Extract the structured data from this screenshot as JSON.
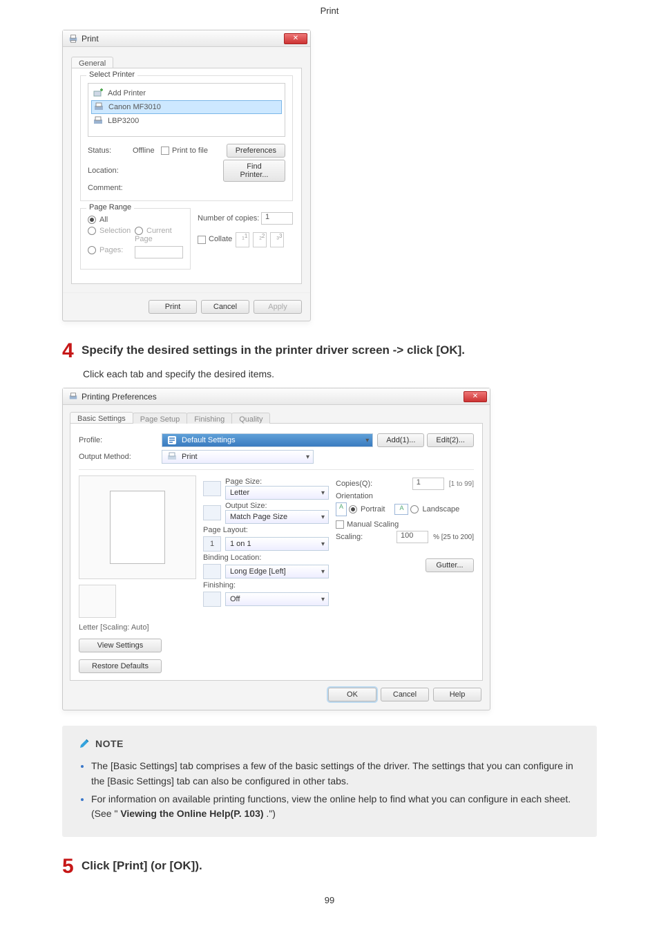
{
  "breadcrumb": "Print",
  "print_dialog": {
    "title": "Print",
    "tab_general": "General",
    "select_printer_legend": "Select Printer",
    "printer_add": "Add Printer",
    "printer_selected": "Canon MF3010",
    "printer_third": "LBP3200",
    "status_lbl": "Status:",
    "status_val": "Offline",
    "location_lbl": "Location:",
    "comment_lbl": "Comment:",
    "print_to_file": "Print to file",
    "preferences_btn": "Preferences",
    "find_printer_btn": "Find Printer...",
    "page_range_legend": "Page Range",
    "opt_all": "All",
    "opt_selection": "Selection",
    "opt_current": "Current Page",
    "opt_pages": "Pages:",
    "num_copies_lbl": "Number of copies:",
    "num_copies_val": "1",
    "collate_lbl": "Collate",
    "coll1": "1",
    "coll2": "2",
    "coll3": "3",
    "btn_print": "Print",
    "btn_cancel": "Cancel",
    "btn_apply": "Apply"
  },
  "step4": {
    "num": "4",
    "text": "Specify the desired settings in the printer driver screen -> click [OK].",
    "sub": "Click each tab and specify the desired items."
  },
  "prefs_dialog": {
    "title": "Printing Preferences",
    "tabs": {
      "basic": "Basic Settings",
      "page": "Page Setup",
      "finishing": "Finishing",
      "quality": "Quality"
    },
    "profile_lbl": "Profile:",
    "profile_val": "Default Settings",
    "add_btn": "Add(1)...",
    "edit_btn": "Edit(2)...",
    "output_lbl": "Output Method:",
    "output_val": "Print",
    "page_size_lbl": "Page Size:",
    "page_size_val": "Letter",
    "output_size_lbl": "Output Size:",
    "output_size_val": "Match Page Size",
    "page_layout_lbl": "Page Layout:",
    "page_layout_val": "1 on 1",
    "binding_lbl": "Binding Location:",
    "binding_val": "Long Edge [Left]",
    "finishing_lbl": "Finishing:",
    "finishing_val": "Off",
    "copies_lbl": "Copies(Q):",
    "copies_val": "1",
    "copies_range": "[1 to 99]",
    "orientation_lbl": "Orientation",
    "portrait_lbl": "Portrait",
    "landscape_lbl": "Landscape",
    "manual_scaling": "Manual Scaling",
    "scaling_lbl": "Scaling:",
    "scaling_val": "100",
    "scaling_range": "% [25 to 200]",
    "gutter_btn": "Gutter...",
    "scale_caption": "Letter [Scaling: Auto]",
    "view_settings_btn": "View Settings",
    "restore_btn": "Restore Defaults",
    "ok_btn": "OK",
    "cancel_btn": "Cancel",
    "help_btn": "Help"
  },
  "note": {
    "title": "NOTE",
    "bullet1": "The [Basic Settings] tab comprises a few of the basic settings of the driver. The settings that you can configure in the [Basic Settings] tab can also be configured in other tabs.",
    "bullet2_a": "For information on available printing functions, view the online help to find what you can configure in each sheet. (See \" ",
    "bullet2_link": "Viewing the Online Help(P. 103)",
    "bullet2_b": " .\")"
  },
  "step5": {
    "num": "5",
    "text": "Click [Print] (or [OK])."
  },
  "pagenum": "99"
}
